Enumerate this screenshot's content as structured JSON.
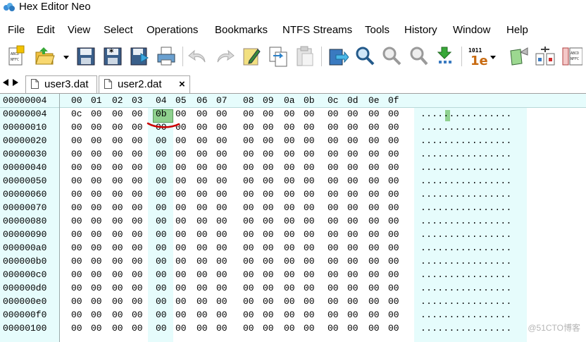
{
  "window": {
    "title": "Hex Editor Neo"
  },
  "menu": [
    "File",
    "Edit",
    "View",
    "Select",
    "Operations",
    "Bookmarks",
    "NTFS Streams",
    "Tools",
    "History",
    "Window",
    "Help"
  ],
  "tabs": [
    {
      "label": "user3.dat",
      "active": false
    },
    {
      "label": "user2.dat",
      "active": true,
      "close": "×"
    }
  ],
  "grid": {
    "corner_offset": "00000004",
    "column_headers": [
      "00",
      "01",
      "02",
      "03",
      "04",
      "05",
      "06",
      "07",
      "08",
      "09",
      "0a",
      "0b",
      "0c",
      "0d",
      "0e",
      "0f"
    ],
    "rows": [
      {
        "offset": "00000004",
        "bytes": [
          "0c",
          "00",
          "00",
          "00",
          "0b",
          "00",
          "00",
          "00",
          "00",
          "00",
          "00",
          "00",
          "00",
          "00",
          "00",
          "00"
        ],
        "ascii": "................"
      },
      {
        "offset": "00000010",
        "bytes": [
          "00",
          "00",
          "00",
          "00",
          "00",
          "00",
          "00",
          "00",
          "00",
          "00",
          "00",
          "00",
          "00",
          "00",
          "00",
          "00"
        ],
        "ascii": "................"
      },
      {
        "offset": "00000020",
        "bytes": [
          "00",
          "00",
          "00",
          "00",
          "00",
          "00",
          "00",
          "00",
          "00",
          "00",
          "00",
          "00",
          "00",
          "00",
          "00",
          "00"
        ],
        "ascii": "................"
      },
      {
        "offset": "00000030",
        "bytes": [
          "00",
          "00",
          "00",
          "00",
          "00",
          "00",
          "00",
          "00",
          "00",
          "00",
          "00",
          "00",
          "00",
          "00",
          "00",
          "00"
        ],
        "ascii": "................"
      },
      {
        "offset": "00000040",
        "bytes": [
          "00",
          "00",
          "00",
          "00",
          "00",
          "00",
          "00",
          "00",
          "00",
          "00",
          "00",
          "00",
          "00",
          "00",
          "00",
          "00"
        ],
        "ascii": "................"
      },
      {
        "offset": "00000050",
        "bytes": [
          "00",
          "00",
          "00",
          "00",
          "00",
          "00",
          "00",
          "00",
          "00",
          "00",
          "00",
          "00",
          "00",
          "00",
          "00",
          "00"
        ],
        "ascii": "................"
      },
      {
        "offset": "00000060",
        "bytes": [
          "00",
          "00",
          "00",
          "00",
          "00",
          "00",
          "00",
          "00",
          "00",
          "00",
          "00",
          "00",
          "00",
          "00",
          "00",
          "00"
        ],
        "ascii": "................"
      },
      {
        "offset": "00000070",
        "bytes": [
          "00",
          "00",
          "00",
          "00",
          "00",
          "00",
          "00",
          "00",
          "00",
          "00",
          "00",
          "00",
          "00",
          "00",
          "00",
          "00"
        ],
        "ascii": "................"
      },
      {
        "offset": "00000080",
        "bytes": [
          "00",
          "00",
          "00",
          "00",
          "00",
          "00",
          "00",
          "00",
          "00",
          "00",
          "00",
          "00",
          "00",
          "00",
          "00",
          "00"
        ],
        "ascii": "................"
      },
      {
        "offset": "00000090",
        "bytes": [
          "00",
          "00",
          "00",
          "00",
          "00",
          "00",
          "00",
          "00",
          "00",
          "00",
          "00",
          "00",
          "00",
          "00",
          "00",
          "00"
        ],
        "ascii": "................"
      },
      {
        "offset": "000000a0",
        "bytes": [
          "00",
          "00",
          "00",
          "00",
          "00",
          "00",
          "00",
          "00",
          "00",
          "00",
          "00",
          "00",
          "00",
          "00",
          "00",
          "00"
        ],
        "ascii": "................"
      },
      {
        "offset": "000000b0",
        "bytes": [
          "00",
          "00",
          "00",
          "00",
          "00",
          "00",
          "00",
          "00",
          "00",
          "00",
          "00",
          "00",
          "00",
          "00",
          "00",
          "00"
        ],
        "ascii": "................"
      },
      {
        "offset": "000000c0",
        "bytes": [
          "00",
          "00",
          "00",
          "00",
          "00",
          "00",
          "00",
          "00",
          "00",
          "00",
          "00",
          "00",
          "00",
          "00",
          "00",
          "00"
        ],
        "ascii": "................"
      },
      {
        "offset": "000000d0",
        "bytes": [
          "00",
          "00",
          "00",
          "00",
          "00",
          "00",
          "00",
          "00",
          "00",
          "00",
          "00",
          "00",
          "00",
          "00",
          "00",
          "00"
        ],
        "ascii": "................"
      },
      {
        "offset": "000000e0",
        "bytes": [
          "00",
          "00",
          "00",
          "00",
          "00",
          "00",
          "00",
          "00",
          "00",
          "00",
          "00",
          "00",
          "00",
          "00",
          "00",
          "00"
        ],
        "ascii": "................"
      },
      {
        "offset": "000000f0",
        "bytes": [
          "00",
          "00",
          "00",
          "00",
          "00",
          "00",
          "00",
          "00",
          "00",
          "00",
          "00",
          "00",
          "00",
          "00",
          "00",
          "00"
        ],
        "ascii": "................"
      },
      {
        "offset": "00000100",
        "bytes": [
          "00",
          "00",
          "00",
          "00",
          "00",
          "00",
          "00",
          "00",
          "00",
          "00",
          "00",
          "00",
          "00",
          "00",
          "00",
          "00"
        ],
        "ascii": "................"
      }
    ],
    "selected": {
      "value": "0b"
    }
  },
  "toolbar": {
    "icons": [
      "new-file-icon",
      "open-file-icon",
      "save-icon",
      "save-all-icon",
      "save-as-icon",
      "print-icon",
      "undo-icon",
      "redo-icon",
      "edit-icon",
      "copy-icon",
      "paste-icon",
      "goto-icon",
      "find-icon",
      "find-next-icon",
      "find-previous-icon",
      "replace-icon",
      "base-converter-icon",
      "fill-icon",
      "compare-icon",
      "structure-viewer-icon"
    ]
  },
  "watermark": "@51CTO博客",
  "colors": {
    "accent_band": "#e6fcfc",
    "selection": "#8fd18f",
    "underline": "#cc0000"
  }
}
